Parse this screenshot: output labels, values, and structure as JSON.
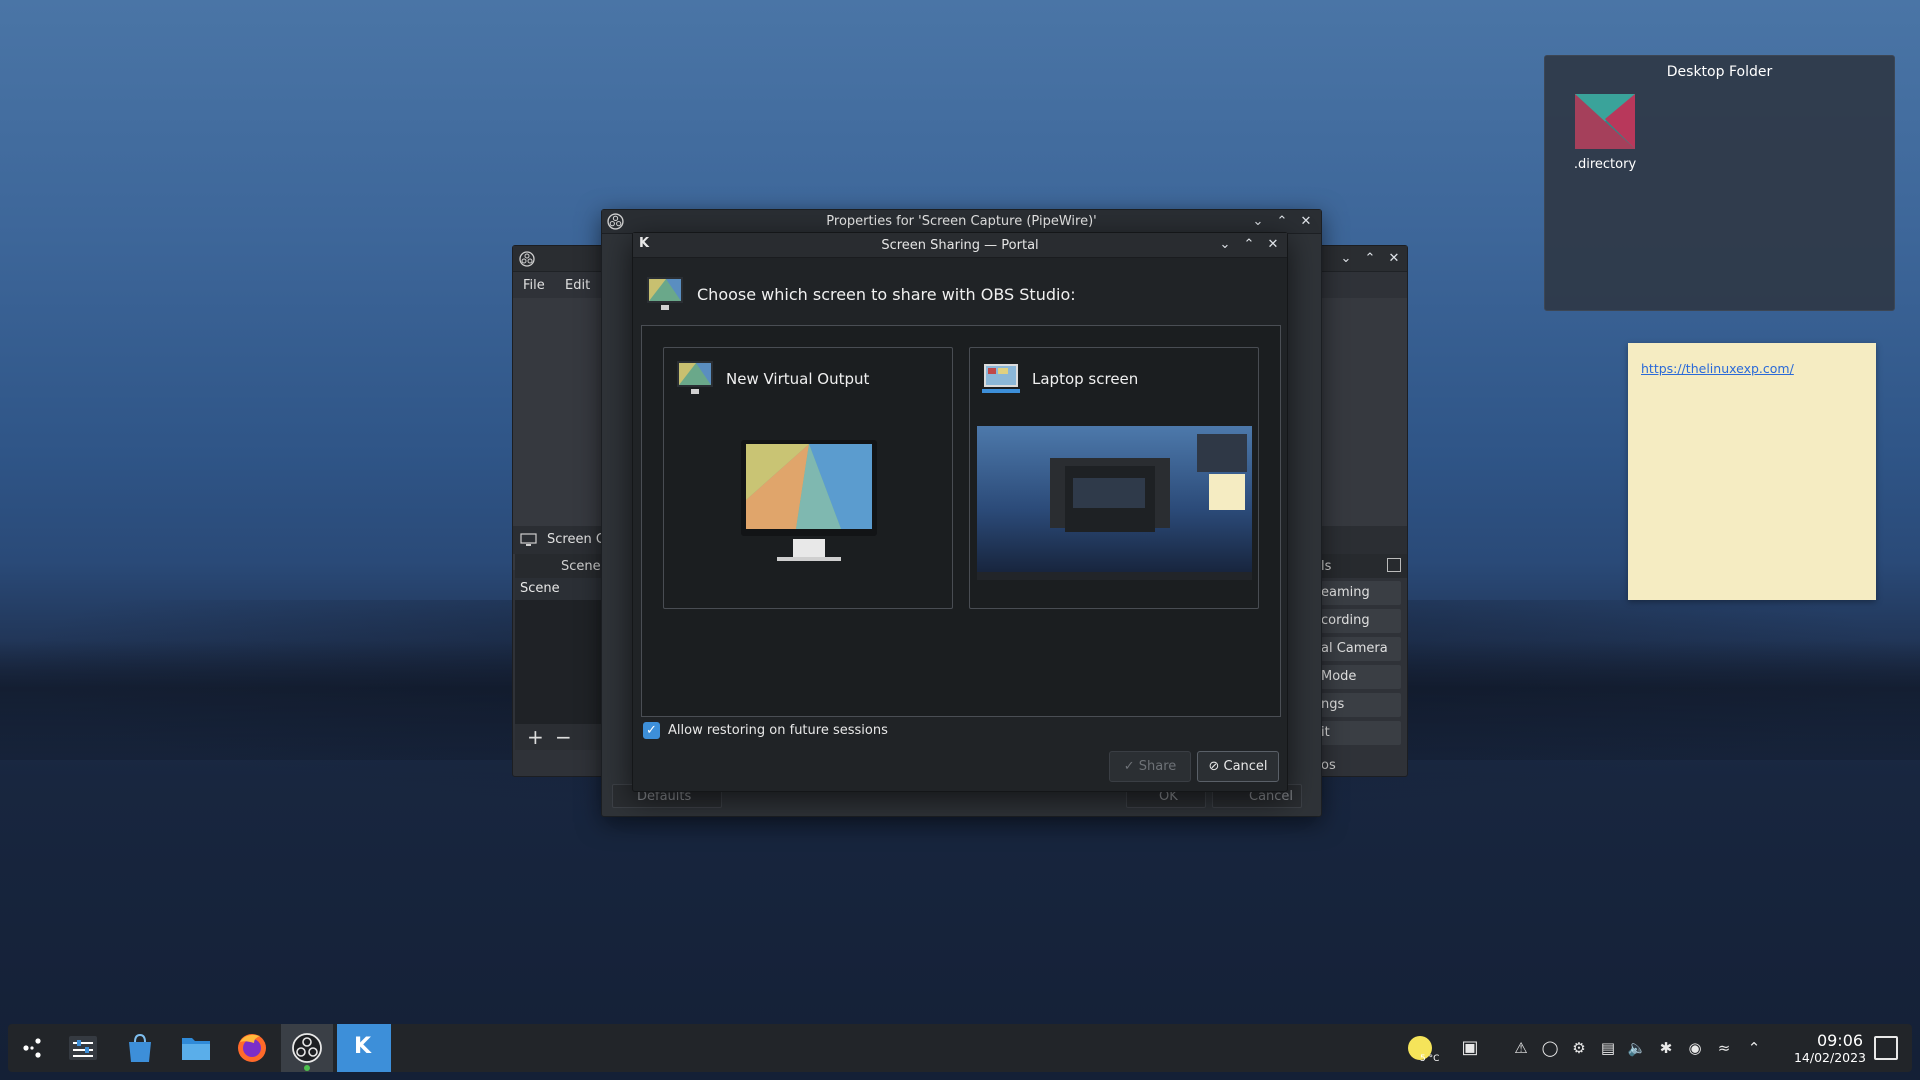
{
  "desktop_folder": {
    "title": "Desktop Folder",
    "item_label": ".directory"
  },
  "sticky_note": {
    "link": "https://thelinuxexp.com/"
  },
  "obs": {
    "menu": [
      "File",
      "Edit"
    ],
    "source_label": "Screen C",
    "scenes_header": "Scenes",
    "scene_item": "Scene",
    "controls": [
      "eaming",
      "cording",
      "al Camera",
      "Mode",
      "ngs",
      "it"
    ],
    "controls_header": "ls",
    "status_text": "os"
  },
  "properties": {
    "title": "Properties for 'Screen Capture (PipeWire)'",
    "defaults_label": "Defaults",
    "ok_label": "OK",
    "cancel_label": "Cancel"
  },
  "portal": {
    "title": "Screen Sharing — Portal",
    "heading": "Choose which screen to share with OBS Studio:",
    "options": [
      {
        "label": "New Virtual Output"
      },
      {
        "label": "Laptop screen"
      }
    ],
    "allow_restore_label": "Allow restoring on future sessions",
    "allow_restore_checked": true,
    "share_label": "Share",
    "cancel_label": "Cancel"
  },
  "taskbar": {
    "weather_temp": "5 °C",
    "time": "09:06",
    "date": "14/02/2023"
  },
  "colors": {
    "accent": "#3d8fd9",
    "note": "#f5ecc2"
  }
}
